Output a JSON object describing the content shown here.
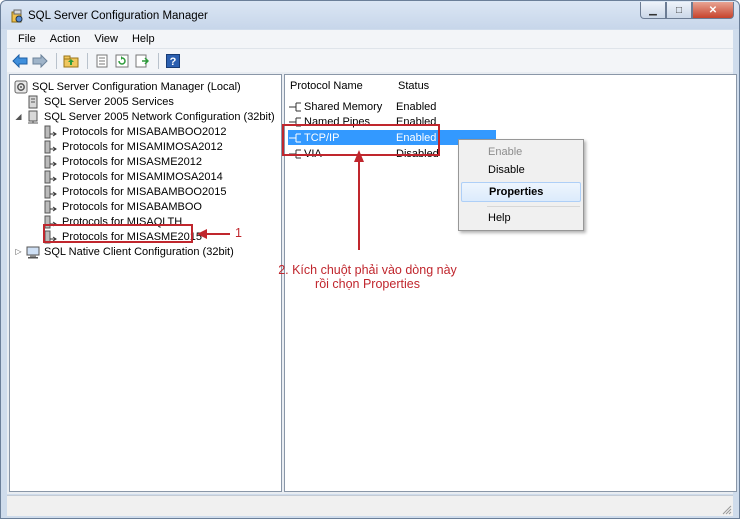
{
  "window": {
    "title": "SQL Server Configuration Manager"
  },
  "menu": [
    {
      "label": "File"
    },
    {
      "label": "Action"
    },
    {
      "label": "View"
    },
    {
      "label": "Help"
    }
  ],
  "tree": {
    "root": "SQL Server Configuration Manager (Local)",
    "services": "SQL Server 2005 Services",
    "network": "SQL Server 2005 Network Configuration (32bit)",
    "protocols": [
      "Protocols for MISABAMBOO2012",
      "Protocols for MISAMIMOSA2012",
      "Protocols for MISASME2012",
      "Protocols for MISAMIMOSA2014",
      "Protocols for MISABAMBOO2015",
      "Protocols for MISABAMBOO",
      "Protocols for MISAQLTH",
      "Protocols for MISASME2015"
    ],
    "native_client": "SQL Native Client Configuration (32bit)"
  },
  "list": {
    "columns": [
      "Protocol Name",
      "Status"
    ],
    "rows": [
      {
        "name": "Shared Memory",
        "status": "Enabled"
      },
      {
        "name": "Named Pipes",
        "status": "Enabled"
      },
      {
        "name": "TCP/IP",
        "status": "Enabled"
      },
      {
        "name": "VIA",
        "status": "Disabled"
      }
    ]
  },
  "context_menu": {
    "enable": "Enable",
    "disable": "Disable",
    "properties": "Properties",
    "help": "Help"
  },
  "annotations": {
    "step1": "1",
    "step2_line1": "2. Kích chuột phải vào dòng này",
    "step2_line2": "rồi chọn Properties"
  },
  "colors": {
    "annotation": "#c0262d",
    "selection": "#3399ff"
  }
}
